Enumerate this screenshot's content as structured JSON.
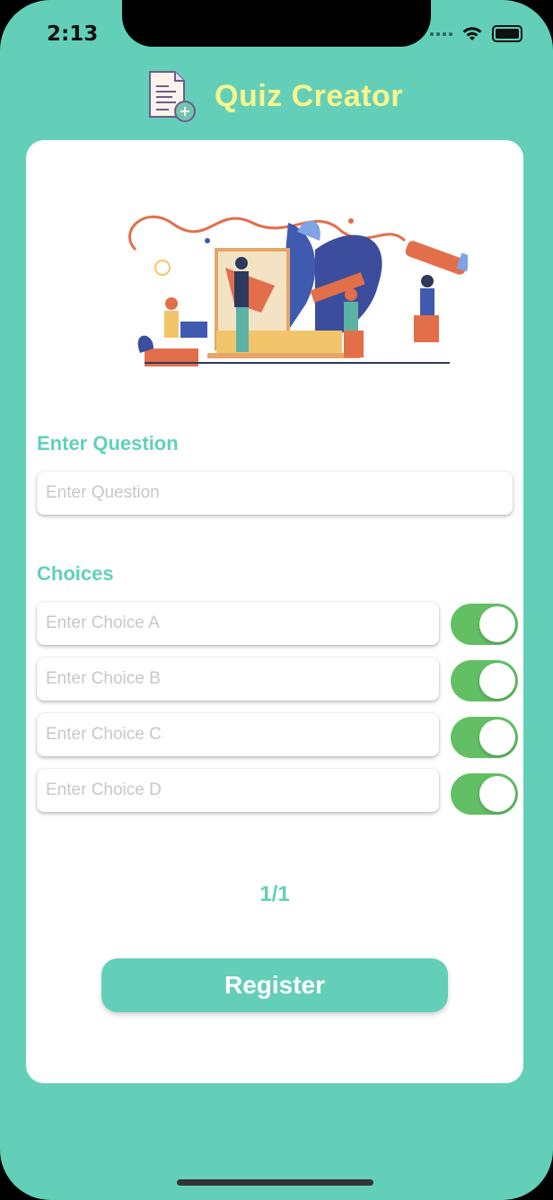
{
  "status_bar": {
    "time": "2:13"
  },
  "header": {
    "title": "Quiz Creator",
    "icon": "document-add-icon"
  },
  "question": {
    "label": "Enter Question",
    "placeholder": "Enter Question",
    "value": ""
  },
  "choices": {
    "label": "Choices",
    "items": [
      {
        "placeholder": "Enter Choice A",
        "value": "",
        "toggle_on": true
      },
      {
        "placeholder": "Enter Choice B",
        "value": "",
        "toggle_on": true
      },
      {
        "placeholder": "Enter Choice C",
        "value": "",
        "toggle_on": true
      },
      {
        "placeholder": "Enter Choice D",
        "value": "",
        "toggle_on": true
      }
    ]
  },
  "pagination": {
    "text": "1/1"
  },
  "actions": {
    "register_label": "Register"
  },
  "colors": {
    "background": "#63cfb8",
    "title": "#f7f58c",
    "accent": "#61d0bb",
    "toggle": "#62bf64"
  }
}
